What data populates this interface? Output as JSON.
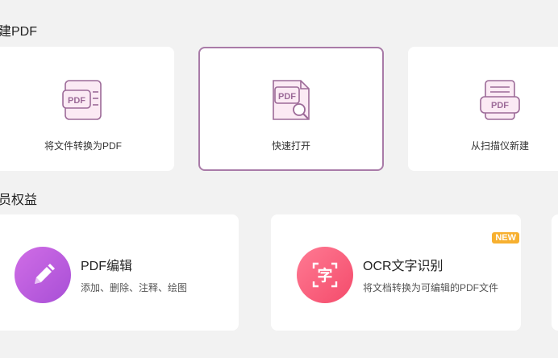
{
  "sections": {
    "create_title": "建PDF",
    "member_title": "员权益"
  },
  "create_cards": [
    {
      "label": "将文件转换为PDF"
    },
    {
      "label": "快速打开"
    },
    {
      "label": "从扫描仪新建"
    }
  ],
  "icon_texts": {
    "pdf": "PDF",
    "char": "字"
  },
  "features": [
    {
      "title": "PDF编辑",
      "desc": "添加、删除、注释、绘图"
    },
    {
      "title": "OCR文字识别",
      "desc": "将文档转换为可编辑的PDF文件",
      "badge": "NEW"
    }
  ],
  "colors": {
    "accent": "#a97ba8",
    "icon_stroke": "#9c6a98",
    "icon_fill": "#fbeaf4",
    "badge": "#f7b030"
  }
}
